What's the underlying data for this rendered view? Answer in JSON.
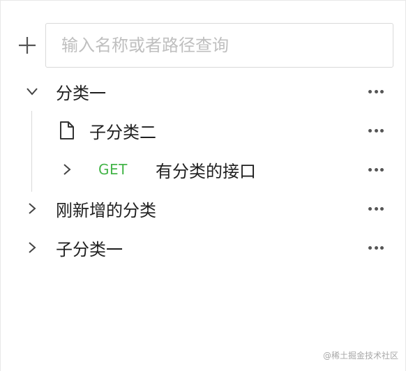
{
  "search": {
    "placeholder": "输入名称或者路径查询"
  },
  "tree": {
    "category_one": {
      "label": "分类一"
    },
    "sub_category_two": {
      "label": "子分类二"
    },
    "api_item": {
      "method": "GET",
      "label": "有分类的接口"
    },
    "new_category": {
      "label": "刚新增的分类"
    },
    "sub_category_one": {
      "label": "子分类一"
    }
  },
  "watermark": "@稀土掘金技术社区",
  "colors": {
    "get_method": "#44b549",
    "border": "#d9d9d9",
    "placeholder": "#bfbfbf"
  }
}
